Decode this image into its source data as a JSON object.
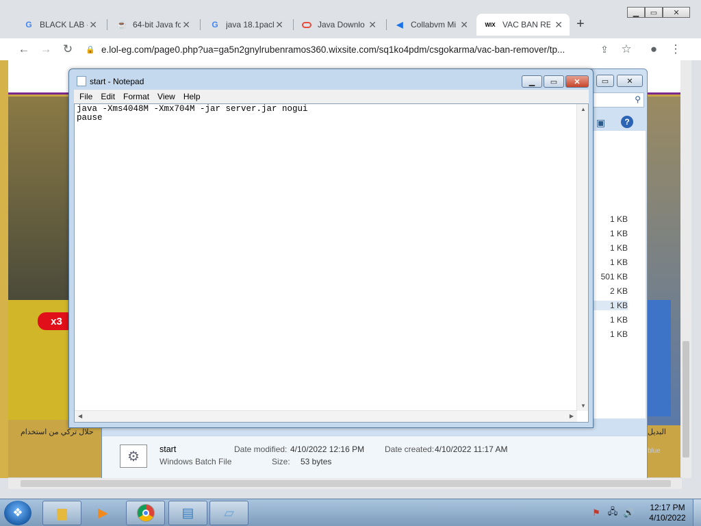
{
  "browser": {
    "tabs": [
      {
        "title": "BLACK LAB -",
        "favicon": "google-g-icon",
        "active": false
      },
      {
        "title": "64-bit Java fo",
        "favicon": "java-icon",
        "active": false
      },
      {
        "title": "java 18.1pack",
        "favicon": "google-g-icon",
        "active": false
      },
      {
        "title": "Java Downlo",
        "favicon": "oracle-icon",
        "active": false
      },
      {
        "title": "Collabvm Mi",
        "favicon": "collabvm-icon",
        "active": false
      },
      {
        "title": "VAC BAN REI",
        "favicon": "wix-icon",
        "active": true
      }
    ],
    "url": "e.lol-eg.com/page0.php?ua=ga5n2gnylrubenramos360.wixsite.com/sq1ko4pdm/csgokarma/vac-ban-remover/tp...",
    "favicon_wix_text": "WIX"
  },
  "explorer": {
    "sizes": [
      "1 KB",
      "1 KB",
      "1 KB",
      "1 KB",
      "501 KB",
      "2 KB",
      "1 KB",
      "1 KB",
      "1 KB"
    ],
    "details": {
      "name": "start",
      "type": "Windows Batch File",
      "date_modified_label": "Date modified:",
      "date_modified": "4/10/2022 12:16 PM",
      "date_created_label": "Date created:",
      "date_created": "4/10/2022 11:17 AM",
      "size_label": "Size:",
      "size": "53 bytes"
    }
  },
  "notepad": {
    "title": "start - Notepad",
    "menu": [
      "File",
      "Edit",
      "Format",
      "View",
      "Help"
    ],
    "content": "java -Xms4048M -Xmx704M -jar server.jar nogui\npause"
  },
  "webpage": {
    "badge": "x3",
    "arabic_left": "حلال تركي من استخدام",
    "arabic_right": "البديل",
    "blue_text": "blue"
  },
  "taskbar": {
    "time": "12:17 PM",
    "date": "4/10/2022"
  },
  "colors": {
    "chrome_tabstrip": "#dee1e6",
    "notepad_frame": "#c4d8ee",
    "taskbar": "#7d9cbc"
  }
}
